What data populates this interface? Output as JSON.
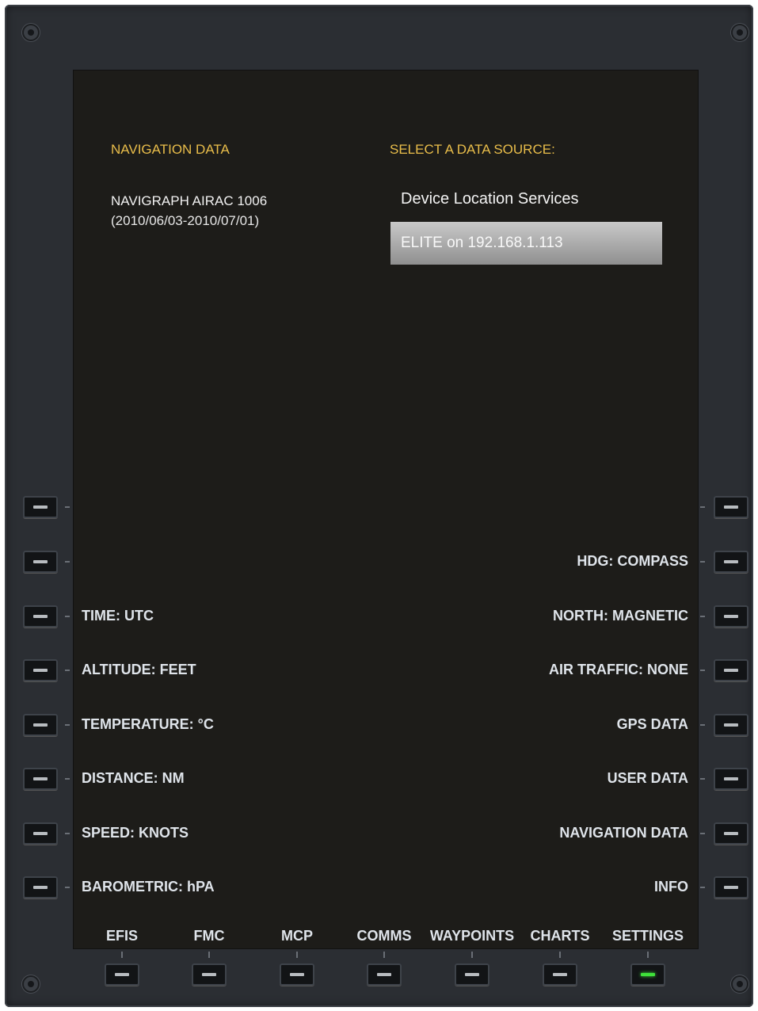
{
  "screen": {
    "nav_header": "NAVIGATION DATA",
    "nav_db_name": "NAVIGRAPH AIRAC 1006",
    "nav_db_dates": "(2010/06/03-2010/07/01)",
    "source_header": "SELECT A DATA SOURCE:",
    "sources": [
      {
        "label": "Device Location Services",
        "selected": false
      },
      {
        "label": "ELITE on 192.168.1.113",
        "selected": true
      }
    ]
  },
  "left_keys": [
    "",
    "",
    "TIME: UTC",
    "ALTITUDE: FEET",
    "TEMPERATURE: °C",
    "DISTANCE: NM",
    "SPEED: KNOTS",
    "BAROMETRIC: hPA"
  ],
  "right_keys": [
    "",
    "HDG: COMPASS",
    "NORTH: MAGNETIC",
    "AIR TRAFFIC: NONE",
    "GPS DATA",
    "USER DATA",
    "NAVIGATION DATA",
    "INFO"
  ],
  "bottom_tabs": [
    {
      "label": "EFIS",
      "active": false
    },
    {
      "label": "FMC",
      "active": false
    },
    {
      "label": "MCP",
      "active": false
    },
    {
      "label": "COMMS",
      "active": false
    },
    {
      "label": "WAYPOINTS",
      "active": false
    },
    {
      "label": "CHARTS",
      "active": false
    },
    {
      "label": "SETTINGS",
      "active": true
    }
  ],
  "colors": {
    "accent": "#e9bd4a",
    "active_led": "#3fe23a",
    "bezel": "#2b2e33"
  }
}
